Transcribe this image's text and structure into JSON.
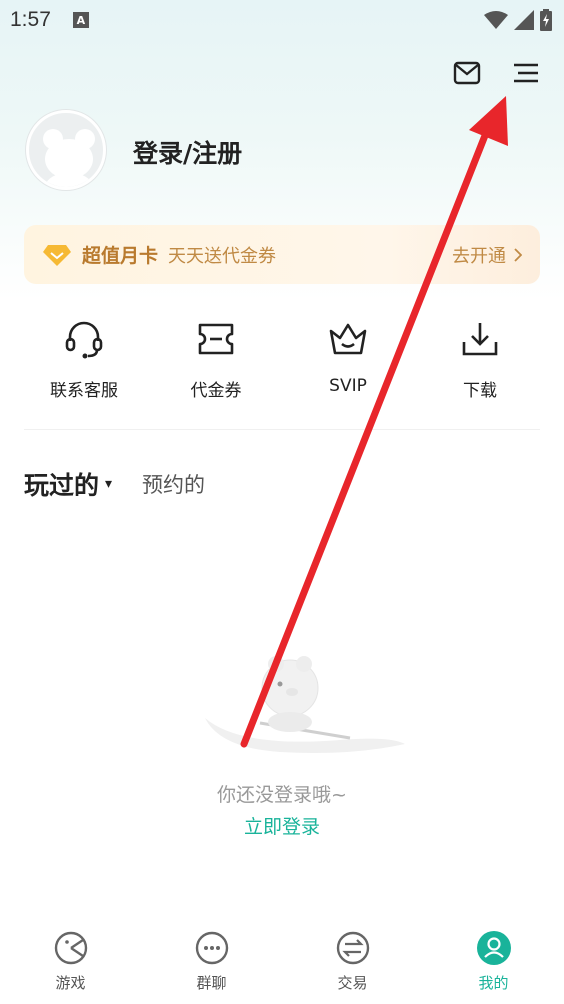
{
  "status_bar": {
    "time": "1:57",
    "notification_letter": "A"
  },
  "header": {
    "mail_icon": "mail-icon",
    "menu_icon": "menu-icon"
  },
  "profile": {
    "login_text": "登录/注册",
    "avatar_icon": "bear-avatar-icon"
  },
  "vip_banner": {
    "name": "超值月卡",
    "desc": "天天送代金券",
    "action": "去开通",
    "accent_color": "#b97a2e"
  },
  "quick_actions": [
    {
      "label": "联系客服",
      "icon": "headset-icon"
    },
    {
      "label": "代金券",
      "icon": "coupon-icon"
    },
    {
      "label": "SVIP",
      "icon": "crown-icon"
    },
    {
      "label": "下载",
      "icon": "download-icon"
    }
  ],
  "tabs": {
    "active": "玩过的",
    "caret": "▾",
    "other": "预约的"
  },
  "empty_state": {
    "message": "你还没登录哦~",
    "link": "立即登录",
    "link_color": "#19b39a"
  },
  "bottom_nav": [
    {
      "label": "游戏",
      "icon": "game-icon"
    },
    {
      "label": "群聊",
      "icon": "chat-icon"
    },
    {
      "label": "交易",
      "icon": "trade-icon"
    },
    {
      "label": "我的",
      "icon": "profile-icon",
      "active": true
    }
  ],
  "annotation": {
    "color": "#e8262b"
  }
}
